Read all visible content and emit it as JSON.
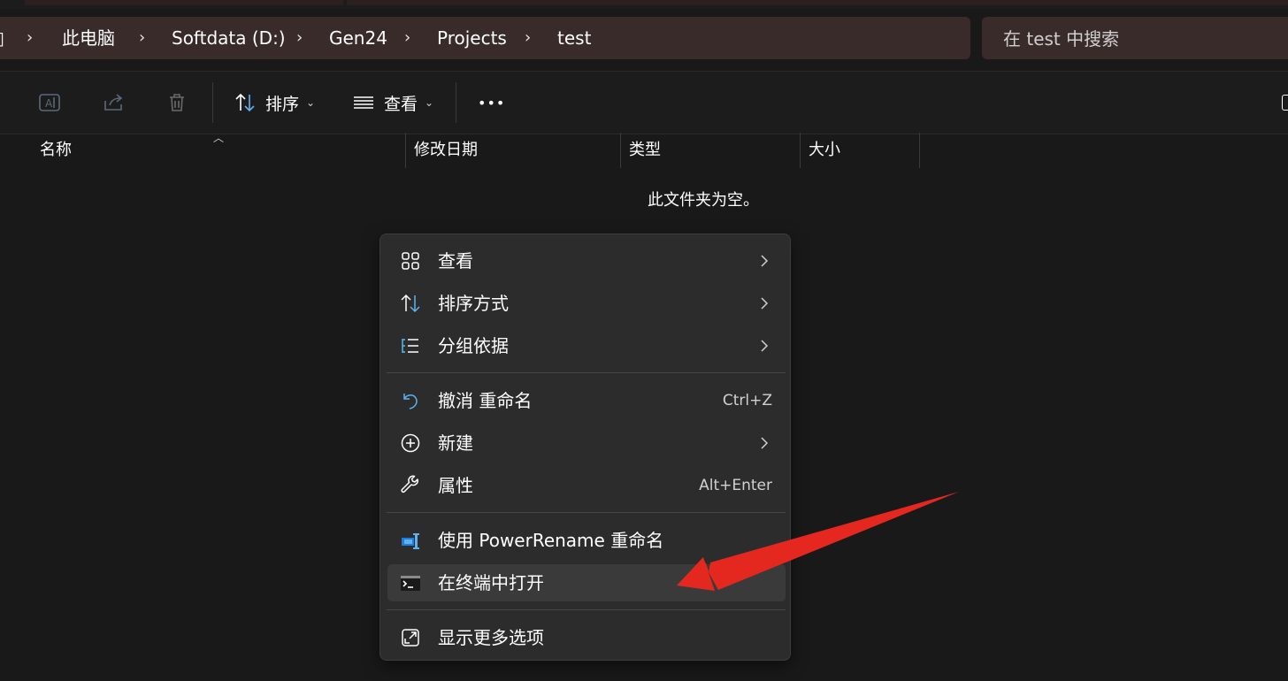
{
  "address_bar": {
    "segments": [
      "此电脑",
      "Softdata (D:)",
      "Gen24",
      "Projects",
      "test"
    ]
  },
  "search": {
    "placeholder": "在 test 中搜索"
  },
  "toolbar": {
    "sort_label": "排序",
    "view_label": "查看",
    "more_label": "•••"
  },
  "columns": {
    "name": "名称",
    "modified": "修改日期",
    "type": "类型",
    "size": "大小"
  },
  "empty_message": "此文件夹为空。",
  "context_menu": {
    "view": {
      "label": "查看"
    },
    "sort_by": {
      "label": "排序方式"
    },
    "group_by": {
      "label": "分组依据"
    },
    "undo_rename": {
      "label": "撤消 重命名",
      "shortcut": "Ctrl+Z"
    },
    "new": {
      "label": "新建"
    },
    "properties": {
      "label": "属性",
      "shortcut": "Alt+Enter"
    },
    "powerrename": {
      "label": "使用 PowerRename 重命名"
    },
    "open_terminal": {
      "label": "在终端中打开"
    },
    "show_more": {
      "label": "显示更多选项"
    }
  },
  "colors": {
    "accent": "#5fb2f2",
    "annotation_arrow": "#e5281f",
    "background": "#191919",
    "menu_background": "#2c2c2c"
  }
}
